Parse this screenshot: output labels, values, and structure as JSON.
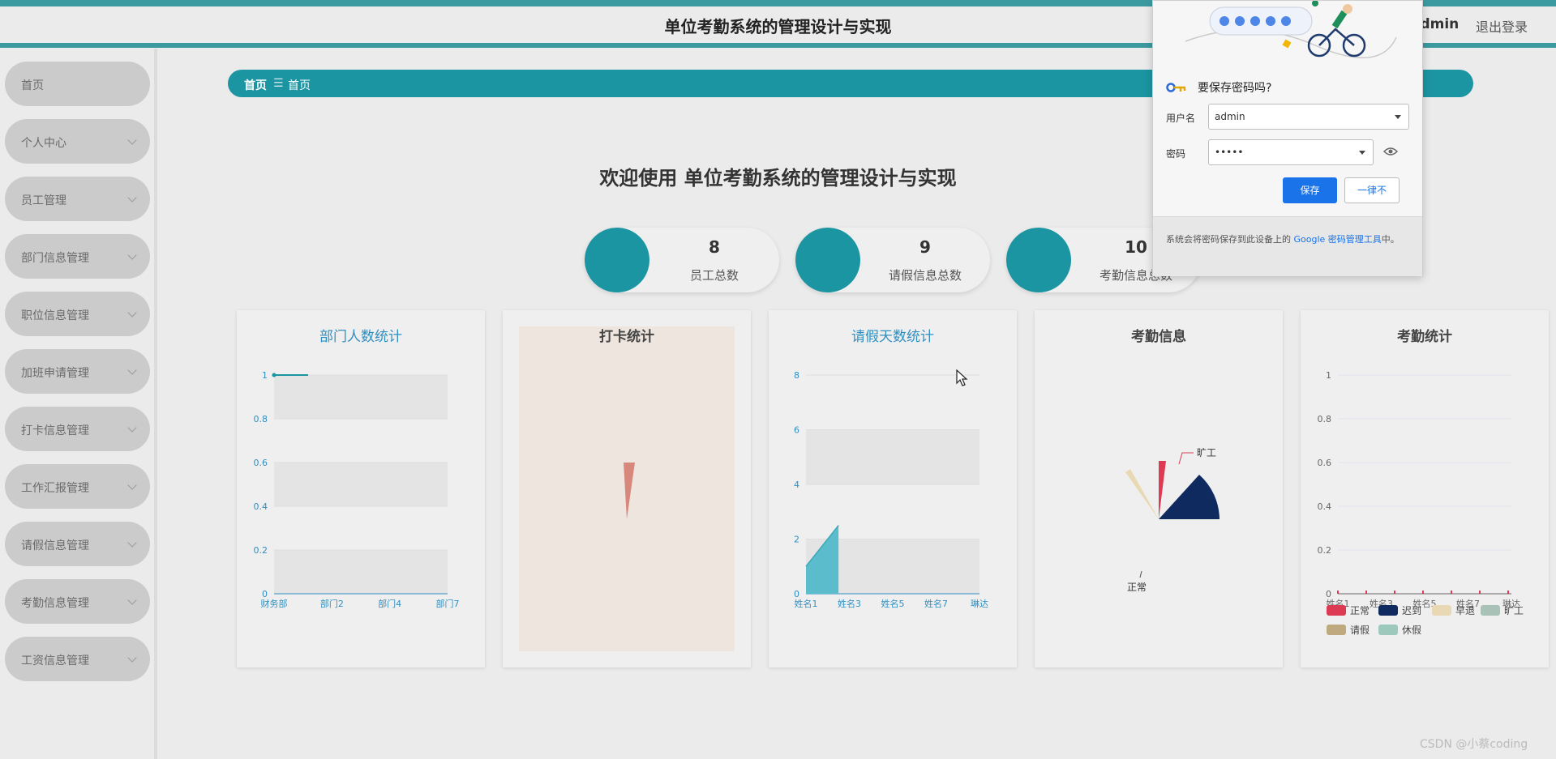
{
  "header": {
    "title": "单位考勤系统的管理设计与实现",
    "user": "admin",
    "logout": "退出登录"
  },
  "sidebar": {
    "items": [
      {
        "label": "首页"
      },
      {
        "label": "个人中心"
      },
      {
        "label": "员工管理"
      },
      {
        "label": "部门信息管理"
      },
      {
        "label": "职位信息管理"
      },
      {
        "label": "加班申请管理"
      },
      {
        "label": "打卡信息管理"
      },
      {
        "label": "工作汇报管理"
      },
      {
        "label": "请假信息管理"
      },
      {
        "label": "考勤信息管理"
      },
      {
        "label": "工资信息管理"
      }
    ]
  },
  "breadcrumb": {
    "home": "首页",
    "sep": "☰",
    "current": "首页"
  },
  "welcome": "欢迎使用 单位考勤系统的管理设计与实现",
  "stats": [
    {
      "value": "8",
      "label": "员工总数"
    },
    {
      "value": "9",
      "label": "请假信息总数"
    },
    {
      "value": "10",
      "label": "考勤信息总数"
    }
  ],
  "chart_data": [
    {
      "type": "line",
      "title": "部门人数统计",
      "categories": [
        "财务部",
        "部门2",
        "部门4",
        "部门7"
      ],
      "y_ticks": [
        "0",
        "0.2",
        "0.4",
        "0.6",
        "0.8",
        "1"
      ],
      "ylim": [
        0,
        1
      ]
    },
    {
      "type": "pie",
      "title": "打卡统计"
    },
    {
      "type": "area",
      "title": "请假天数统计",
      "categories": [
        "姓名1",
        "姓名3",
        "姓名5",
        "姓名7",
        "琳达"
      ],
      "y_ticks": [
        "0",
        "2",
        "4",
        "6",
        "8"
      ],
      "ylim": [
        0,
        8
      ],
      "values": [
        1,
        2.5
      ]
    },
    {
      "type": "pie",
      "title": "考勤信息",
      "labels": [
        "旷工",
        "正常"
      ]
    },
    {
      "type": "bar",
      "title": "考勤统计",
      "categories": [
        "姓名1",
        "姓名3",
        "姓名5",
        "姓名7",
        "琳达"
      ],
      "y_ticks": [
        "0",
        "0.2",
        "0.4",
        "0.6",
        "0.8",
        "1"
      ],
      "ylim": [
        0,
        1
      ],
      "legend": [
        "正常",
        "迟到",
        "早退",
        "旷工",
        "请假",
        "休假"
      ],
      "legend_colors": [
        "#dd3b54",
        "#0f2a5e",
        "#e9d8b4",
        "#a9c2b8",
        "#bfa97e",
        "#9cc9bb"
      ]
    }
  ],
  "popup": {
    "question": "要保存密码吗?",
    "username_label": "用户名",
    "username_value": "admin",
    "password_label": "密码",
    "password_value": "•••••",
    "save": "保存",
    "never": "一律不",
    "footer_prefix": "系统会将密码保存到此设备上的 ",
    "footer_link": "Google 密码管理工具",
    "footer_suffix": "中。"
  },
  "watermark": "CSDN @小蔡coding"
}
